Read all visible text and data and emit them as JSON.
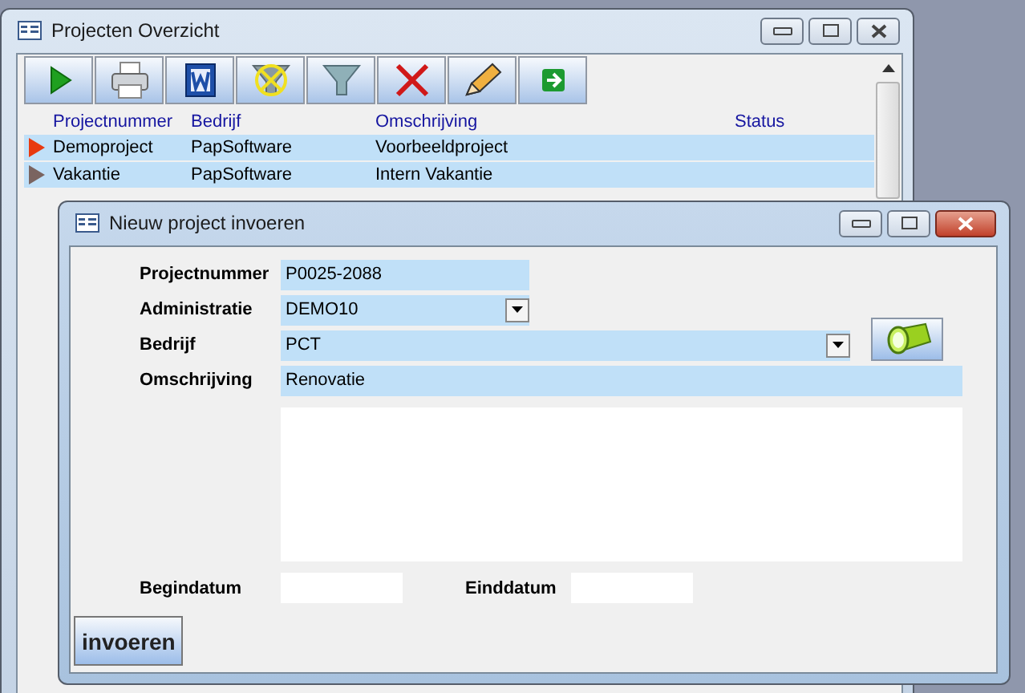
{
  "main_window": {
    "title": "Projecten Overzicht",
    "toolbar": [
      {
        "kind": "play"
      },
      {
        "kind": "print"
      },
      {
        "kind": "word"
      },
      {
        "kind": "clear-filter"
      },
      {
        "kind": "filter"
      },
      {
        "kind": "delete"
      },
      {
        "kind": "edit"
      },
      {
        "kind": "export"
      }
    ],
    "table": {
      "columns": [
        "Projectnummer",
        "Bedrijf",
        "Omschrijving",
        "Status"
      ],
      "rows": [
        {
          "selected": true,
          "cells": [
            "Demoproject",
            "PapSoftware",
            "Voorbeeldproject"
          ]
        },
        {
          "selected": false,
          "cells": [
            "Vakantie",
            "PapSoftware",
            "Intern Vakantie"
          ]
        }
      ]
    }
  },
  "dialog": {
    "title": "Nieuw project invoeren",
    "fields": [
      {
        "kind": "text",
        "label": "Projectnummer",
        "value": "P0025-2088"
      },
      {
        "kind": "dropdown",
        "label": "Administratie",
        "value": "DEMO10"
      },
      {
        "kind": "dropdown-wide",
        "label": "Bedrijf",
        "value": "PCT"
      },
      {
        "kind": "wide",
        "label": "Omschrijving",
        "value": "Renovatie"
      }
    ],
    "dates": [
      {
        "label": "Begindatum"
      },
      {
        "label": "Einddatum"
      }
    ],
    "button": "invoeren"
  }
}
